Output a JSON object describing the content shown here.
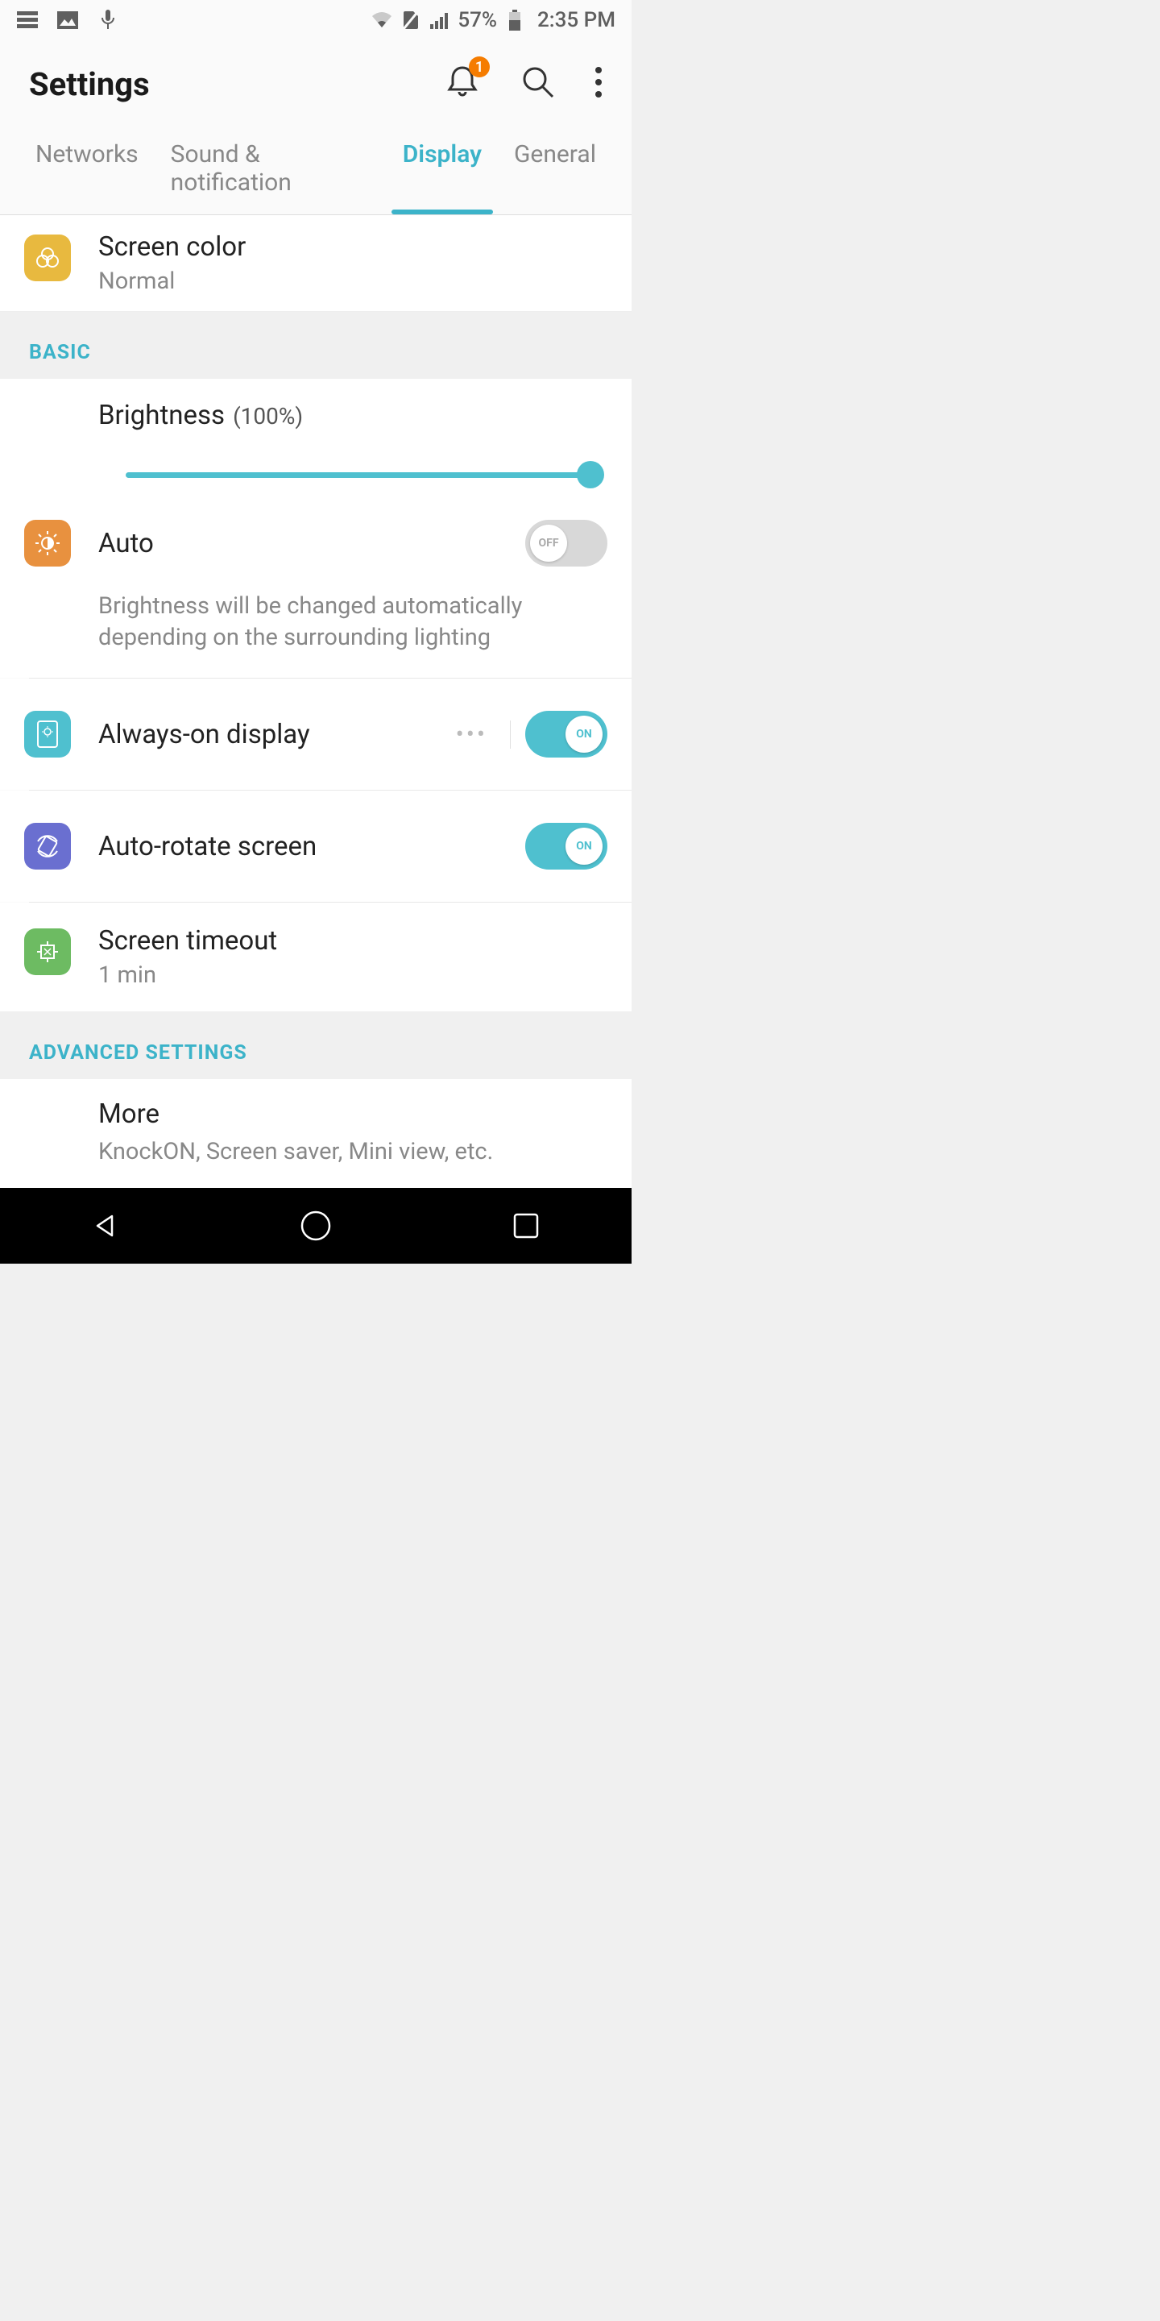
{
  "status": {
    "battery_pct": "57%",
    "time": "2:35 PM",
    "notification_badge": "1"
  },
  "header": {
    "title": "Settings"
  },
  "tabs": {
    "networks": "Networks",
    "sound": "Sound & notification",
    "display": "Display",
    "general": "General",
    "active": "display"
  },
  "items": {
    "screen_color": {
      "title": "Screen color",
      "value": "Normal"
    },
    "brightness": {
      "title": "Brightness",
      "pct": "(100%)",
      "value": 100
    },
    "auto": {
      "title": "Auto",
      "desc": "Brightness will be changed automatically depending on the surrounding lighting",
      "state": "OFF"
    },
    "aod": {
      "title": "Always-on display",
      "state": "ON"
    },
    "rotate": {
      "title": "Auto-rotate screen",
      "state": "ON"
    },
    "timeout": {
      "title": "Screen timeout",
      "value": "1 min"
    },
    "more": {
      "title": "More",
      "sub": "KnockON, Screen saver, Mini view, etc."
    }
  },
  "sections": {
    "basic": "BASIC",
    "advanced": "ADVANCED SETTINGS"
  }
}
